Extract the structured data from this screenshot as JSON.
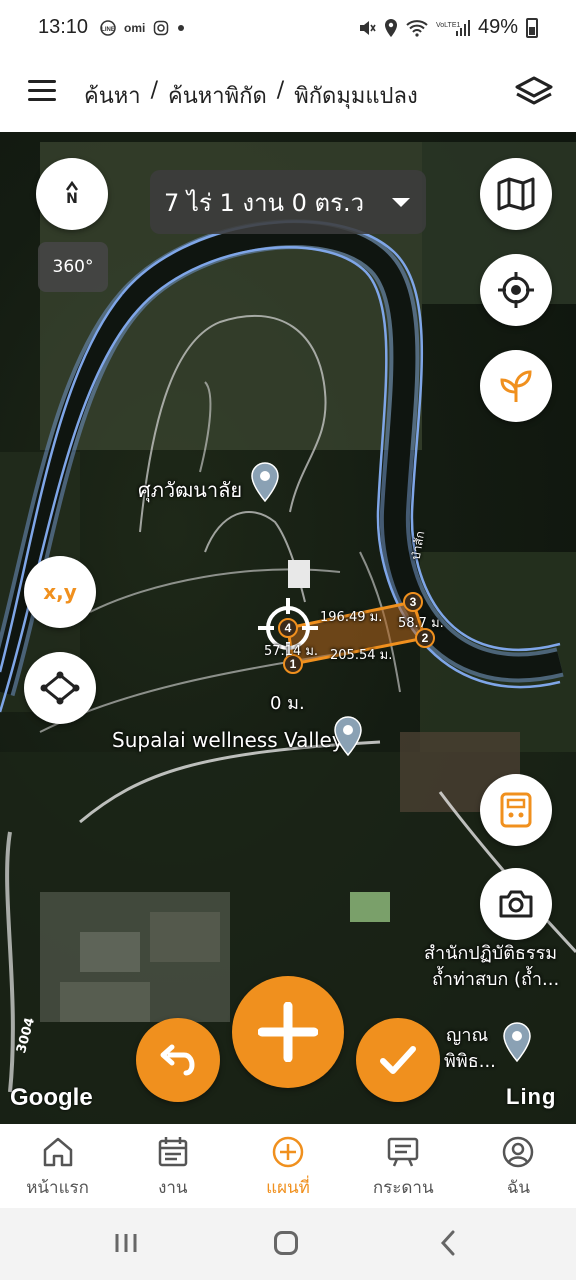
{
  "status_bar": {
    "time": "13:10",
    "app_icons": [
      "LINE",
      "omi",
      "instagram-icon",
      "dot"
    ],
    "battery": "49%"
  },
  "header": {
    "breadcrumb": [
      "ค้นหา",
      "/",
      "ค้นหาพิกัด",
      "/",
      "พิกัดมุมแปลง"
    ]
  },
  "map": {
    "compass_label": "N",
    "view_360": "360°",
    "area_summary": "7 ไร่ 1 งาน 0 ตร.ว",
    "xy_label": "x,y",
    "place_labels": {
      "school": "ศุภวัฒนาลัย",
      "valley": "Supalai wellness Valley",
      "temple_line1": "สำนักปฏิบัติธรรม",
      "temple_line2": "ถ้ำท่าสบก (ถ้ำ...",
      "temple2_line1": "ญาณ",
      "temple2_line2": "พิพิธ..."
    },
    "zero_distance": "0 ม.",
    "segments": {
      "seg_4_3": "196.49 ม.",
      "seg_3_2": "58.7 ม.",
      "seg_2_1": "205.54 ม.",
      "seg_1_4": "57.14 ม."
    },
    "vertices": [
      "1",
      "2",
      "3",
      "4"
    ],
    "river_label": "ป่าสัก",
    "road_label": "3004",
    "attribution": "Google",
    "ling_label": "Ling"
  },
  "bottom_nav": [
    {
      "label": "หน้าแรก",
      "icon": "home-icon"
    },
    {
      "label": "งาน",
      "icon": "calendar-icon"
    },
    {
      "label": "แผนที่",
      "icon": "add-circle-icon",
      "active": true
    },
    {
      "label": "กระดาน",
      "icon": "board-icon"
    },
    {
      "label": "ฉัน",
      "icon": "user-icon"
    }
  ],
  "colors": {
    "accent": "#f0901e",
    "river": "#7fa6e8"
  }
}
